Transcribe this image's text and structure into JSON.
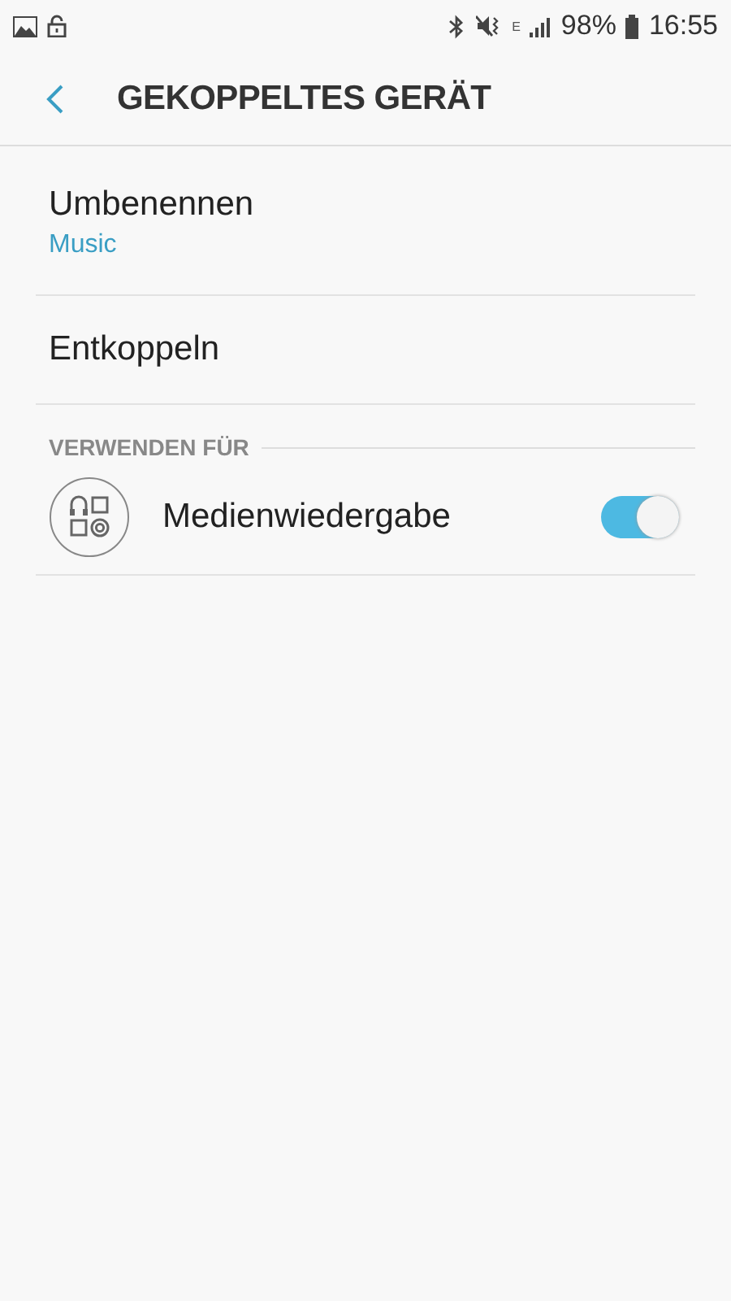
{
  "status_bar": {
    "network": "E",
    "battery": "98%",
    "time": "16:55"
  },
  "header": {
    "title": "GEKOPPELTES GERÄT"
  },
  "items": [
    {
      "title": "Umbenennen",
      "subtitle": "Music"
    },
    {
      "title": "Entkoppeln"
    }
  ],
  "section": {
    "title": "VERWENDEN FÜR",
    "options": [
      {
        "label": "Medienwiedergabe",
        "on": true
      }
    ]
  }
}
